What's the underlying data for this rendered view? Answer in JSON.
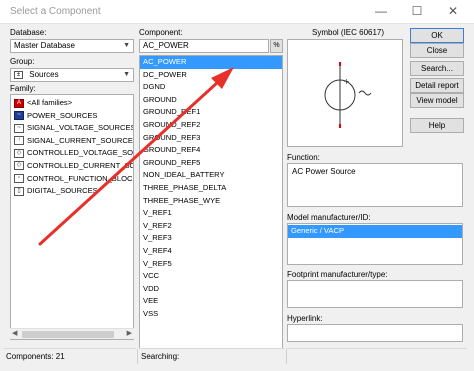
{
  "window": {
    "title": "Select a Component",
    "minimize_glyph": "—",
    "maximize_glyph": "☐",
    "close_glyph": "✕"
  },
  "database": {
    "label": "Database:",
    "value": "Master Database"
  },
  "group": {
    "label": "Group:",
    "value": "Sources"
  },
  "family": {
    "label": "Family:",
    "items": [
      {
        "label": "<All families>",
        "icon": "all-families-icon"
      },
      {
        "label": "POWER_SOURCES",
        "icon": "power-sources-icon"
      },
      {
        "label": "SIGNAL_VOLTAGE_SOURCES",
        "icon": "signal-voltage-icon"
      },
      {
        "label": "SIGNAL_CURRENT_SOURCES",
        "icon": "signal-current-icon"
      },
      {
        "label": "CONTROLLED_VOLTAGE_SOUR",
        "icon": "controlled-voltage-icon"
      },
      {
        "label": "CONTROLLED_CURRENT_SOUR",
        "icon": "controlled-current-icon"
      },
      {
        "label": "CONTROL_FUNCTION_BLOCKS",
        "icon": "control-function-icon"
      },
      {
        "label": "DIGITAL_SOURCES",
        "icon": "digital-sources-icon"
      }
    ]
  },
  "component": {
    "label": "Component:",
    "search_value": "AC_POWER",
    "filter_glyph": "%",
    "items": [
      "AC_POWER",
      "DC_POWER",
      "DGND",
      "GROUND",
      "GROUND_REF1",
      "GROUND_REF2",
      "GROUND_REF3",
      "GROUND_REF4",
      "GROUND_REF5",
      "NON_IDEAL_BATTERY",
      "THREE_PHASE_DELTA",
      "THREE_PHASE_WYE",
      "V_REF1",
      "V_REF2",
      "V_REF3",
      "V_REF4",
      "V_REF5",
      "VCC",
      "VDD",
      "VEE",
      "VSS"
    ],
    "selected": "AC_POWER"
  },
  "symbol": {
    "label": "Symbol (IEC 60617)"
  },
  "buttons": {
    "ok": "OK",
    "close": "Close",
    "search": "Search...",
    "detail_report": "Detail report",
    "view_model": "View model",
    "help": "Help"
  },
  "function": {
    "label": "Function:",
    "value": "AC Power Source"
  },
  "model_manufacturer": {
    "label": "Model manufacturer/ID:",
    "items": [
      "Generic / VACP"
    ]
  },
  "footprint_manufacturer": {
    "label": "Footprint manufacturer/type:"
  },
  "hyperlink": {
    "label": "Hyperlink:"
  },
  "status": {
    "components": "Components: 21",
    "searching": "Searching:"
  },
  "colors": {
    "selection": "#3399ff",
    "annotation_arrow": "#e8302a",
    "window_bg": "#f0f0f0"
  }
}
